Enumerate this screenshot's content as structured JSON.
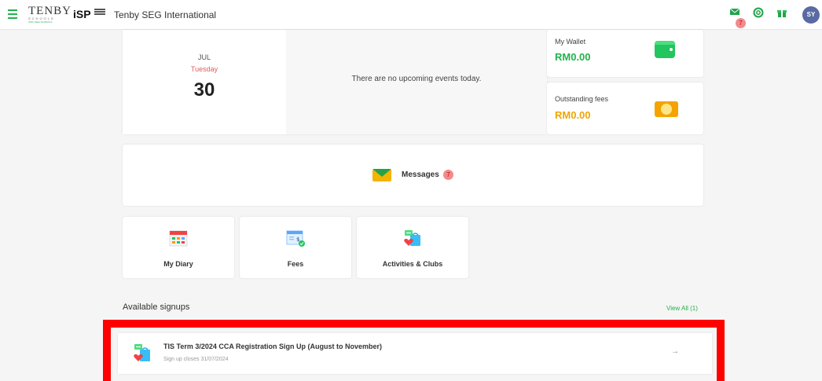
{
  "header": {
    "logo_tenby": "TENBY",
    "logo_tenby_sub": "SCHOOLS",
    "logo_tenby_tiny": "WITH SEG SCHOOLS",
    "logo_isp": "iSP",
    "school_name": "Tenby SEG International",
    "mail_badge": "7",
    "avatar_initials": "SY"
  },
  "calendar": {
    "month": "JUL",
    "weekday": "Tuesday",
    "day": "30",
    "no_events_text": "There are no upcoming events today."
  },
  "wallet": {
    "label": "My Wallet",
    "value": "RM0.00"
  },
  "outstanding_fees": {
    "label": "Outstanding fees",
    "value": "RM0.00"
  },
  "messages": {
    "label": "Messages",
    "count": "7"
  },
  "tiles": [
    {
      "label": "My Diary",
      "icon": "diary-icon"
    },
    {
      "label": "Fees",
      "icon": "fees-icon"
    },
    {
      "label": "Activities & Clubs",
      "icon": "activities-icon"
    }
  ],
  "signups": {
    "title": "Available signups",
    "view_all": "View All (1)",
    "items": [
      {
        "title": "TIS Term 3/2024 CCA Registration Sign Up (August to November)",
        "subtitle": "Sign up closes 31/07/2024",
        "arrow": "→"
      }
    ]
  },
  "colors": {
    "accent": "#22b24c",
    "fees_value": "#f0a500",
    "highlight": "#ff0000",
    "avatar": "#5a6aa3"
  }
}
